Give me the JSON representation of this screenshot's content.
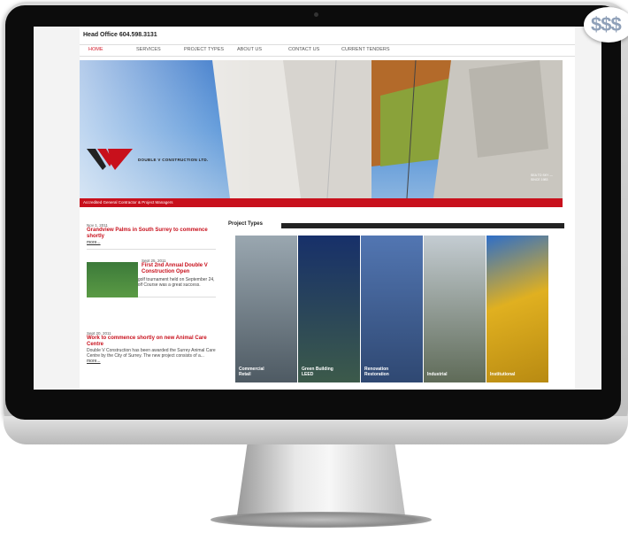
{
  "badge": {
    "text": "$$$"
  },
  "site": {
    "phone": "Head Office 604.598.3131",
    "nav": [
      "HOME",
      "SERVICES",
      "PROJECT TYPES",
      "ABOUT US",
      "CONTACT US",
      "CURRENT TENDERS"
    ],
    "nav_active": "HOME",
    "logo": "DOUBLE V CONSTRUCTION LTD.",
    "hero_caption": "SEA TO SKY — SINCE 1983",
    "tagline": "Accredited General Contractor & Project Managers",
    "news": [
      {
        "date": "Nov 1, 2011",
        "title": "Grandview Palms in South Surrey to commence shortly",
        "body": "",
        "more": "more..."
      },
      {
        "date": "Sept 25, 2011",
        "title": "First 2nd Annual Double V Construction Open",
        "body": "The 2nd annual company golf tournament held on September 24, 2011 at the Cultus Lake Golf Course was a great success.",
        "more": "more..."
      },
      {
        "date": "Sept 20, 2011",
        "title": "Work to commence shortly on new Animal Care Centre",
        "body": "Double V Construction has been awarded the Surrey Animal Care Centre by the City of Surrey. The new project consists of a...",
        "more": "more..."
      }
    ],
    "project_types_title": "Project Types",
    "projects": [
      {
        "label": "Commercial\nRetail",
        "color": "#5a6a78"
      },
      {
        "label": "Green Building\nLEED",
        "color": "#1f3f78"
      },
      {
        "label": "Renovation\nRestoration",
        "color": "#3f5a8f"
      },
      {
        "label": "Industrial",
        "color": "#6a7b8a"
      },
      {
        "label": "Institutional",
        "color": "#c99a18"
      }
    ]
  },
  "colors": {
    "accent_red": "#c8101c",
    "bezel": "#0c0c0c"
  }
}
